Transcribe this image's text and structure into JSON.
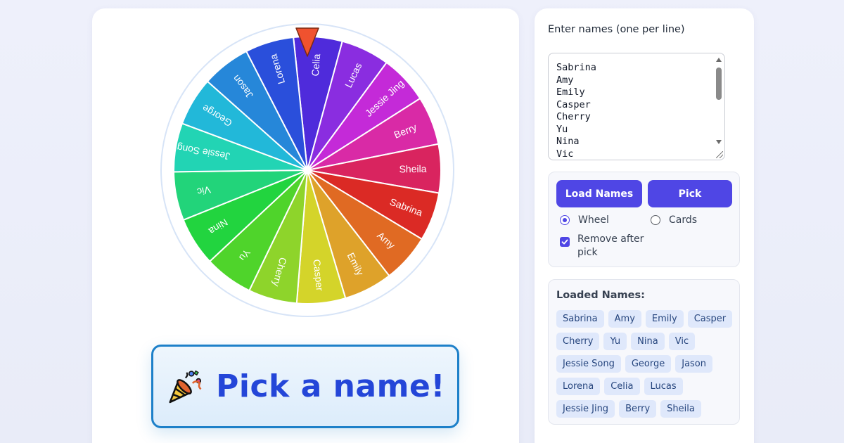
{
  "wheel": {
    "segments": [
      {
        "label": "Celia",
        "color": "#4f2bdb"
      },
      {
        "label": "Lucas",
        "color": "#8a2de0"
      },
      {
        "label": "Jessie Jing",
        "color": "#c42ad8"
      },
      {
        "label": "Berry",
        "color": "#d92aa6"
      },
      {
        "label": "Sheila",
        "color": "#d9245f"
      },
      {
        "label": "Sabrina",
        "color": "#db2a25"
      },
      {
        "label": "Amy",
        "color": "#e06a23"
      },
      {
        "label": "Emily",
        "color": "#dea22a"
      },
      {
        "label": "Casper",
        "color": "#d4d42a"
      },
      {
        "label": "Cherry",
        "color": "#8ed42b"
      },
      {
        "label": "Yu",
        "color": "#4fd42b"
      },
      {
        "label": "Nina",
        "color": "#22d43f"
      },
      {
        "label": "Vic",
        "color": "#22d47a"
      },
      {
        "label": "Jessie Song",
        "color": "#22d4b4"
      },
      {
        "label": "George",
        "color": "#22b8d9"
      },
      {
        "label": "Jason",
        "color": "#2687d9"
      },
      {
        "label": "Lorena",
        "color": "#2a4fdb"
      }
    ],
    "pointer_color": "#f0522f"
  },
  "spin_button": {
    "label": "Pick a name!",
    "icon": "party-popper-icon"
  },
  "sidebar": {
    "names_label": "Enter names (one per line)",
    "names_text": "Sabrina\nAmy\nEmily\nCasper\nCherry\nYu\nNina\nVic",
    "load_button": "Load Names",
    "pick_button": "Pick",
    "mode_wheel": "Wheel",
    "mode_cards": "Cards",
    "mode_selected": "Wheel",
    "remove_after_pick": "Remove after pick",
    "remove_checked": true,
    "loaded_title": "Loaded Names:",
    "loaded_names": [
      "Sabrina",
      "Amy",
      "Emily",
      "Casper",
      "Cherry",
      "Yu",
      "Nina",
      "Vic",
      "Jessie Song",
      "George",
      "Jason",
      "Lorena",
      "Celia",
      "Lucas",
      "Jessie Jing",
      "Berry",
      "Sheila"
    ]
  },
  "colors": {
    "accent": "#4f46e5",
    "spin_text": "#2446d8",
    "spin_border": "#1d80c9"
  }
}
